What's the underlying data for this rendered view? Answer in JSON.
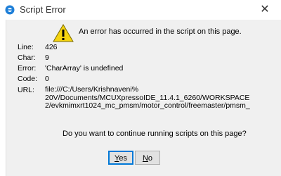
{
  "window": {
    "title": "Script Error",
    "close_glyph": "✕"
  },
  "message": {
    "headline": "An error has occurred in the script on this page.",
    "icon": "warning-icon"
  },
  "details": {
    "line_label": "Line:",
    "line_value": "426",
    "char_label": "Char:",
    "char_value": "9",
    "error_label": "Error:",
    "error_value": "'CharArray' is undefined",
    "code_label": "Code:",
    "code_value": "0",
    "url_label": "URL:",
    "url_lines": [
      "file:///C:/Users/Krishnaveni%",
      "20V/Documents/MCUXpressoIDE_11.4.1_6260/WORKSPACE",
      "2/evkmimxrt1024_mc_pmsm/motor_control/freemaster/pmsm_"
    ]
  },
  "prompt": {
    "question": "Do you want to continue running scripts on this page?"
  },
  "buttons": {
    "yes_accel": "Y",
    "yes_rest": "es",
    "no_accel": "N",
    "no_rest": "o"
  },
  "colors": {
    "warning_fill": "#f5d40f",
    "accent_border": "#0078d7"
  }
}
